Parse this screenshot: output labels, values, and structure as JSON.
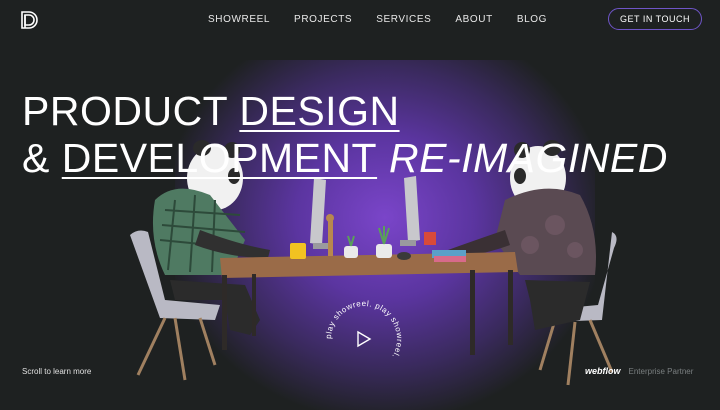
{
  "nav": {
    "links": [
      "SHOWREEL",
      "PROJECTS",
      "SERVICES",
      "ABOUT",
      "BLOG"
    ],
    "cta_label": "GET IN TOUCH"
  },
  "hero": {
    "line1_a": "PRODUCT ",
    "line1_b": "DESIGN",
    "line2_a": "& ",
    "line2_b": "DEVELOPMENT",
    "line2_c": " RE-IMAGINED"
  },
  "showreel": {
    "ring_text": "play showreel. play showreel. "
  },
  "footer": {
    "scroll_hint": "Scroll to learn more",
    "partner_brand": "webflow",
    "partner_label": "Enterprise Partner"
  },
  "colors": {
    "background": "#1e2121",
    "accent": "#6f55c8",
    "glow": "#7a45c9"
  },
  "icons": {
    "logo": "logo-icon",
    "play": "play-icon"
  }
}
